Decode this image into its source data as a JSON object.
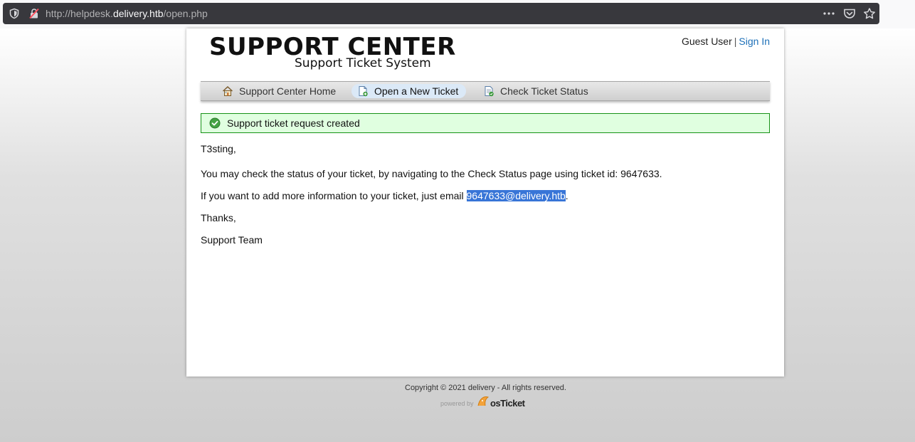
{
  "browser": {
    "url_prefix": "http://helpdesk.",
    "url_host": "delivery.htb",
    "url_path": "/open.php",
    "icons": [
      "shield-icon",
      "insecure-lock-icon",
      "more-icon",
      "pocket-icon",
      "bookmark-star-icon"
    ]
  },
  "header": {
    "title": "SUPPORT CENTER",
    "subtitle": "Support Ticket System",
    "guest_label": "Guest User",
    "separator": "|",
    "sign_in": "Sign In"
  },
  "nav": {
    "items": [
      {
        "label": "Support Center Home",
        "icon": "home-icon"
      },
      {
        "label": "Open a New Ticket",
        "icon": "new-ticket-icon"
      },
      {
        "label": "Check Ticket Status",
        "icon": "ticket-status-icon"
      }
    ],
    "active_index": 1
  },
  "notice": {
    "message": "Support ticket request created",
    "color": "#e0ffe0",
    "border_color": "#179317"
  },
  "content": {
    "greeting": "T3sting,",
    "status_line": "You may check the status of your ticket, by navigating to the Check Status page using ticket id: 9647633.",
    "email_prefix": "If you want to add more information to your ticket, just email ",
    "email": "9647633@delivery.htb",
    "email_suffix": ".",
    "thanks": "Thanks,",
    "signature": "Support Team"
  },
  "footer": {
    "copyright": "Copyright © 2021 delivery - All rights reserved.",
    "powered_by": "powered by",
    "brand": "osTicket"
  },
  "colors": {
    "link": "#1d70b8",
    "selection": "#3875d7",
    "urlbar": "#38383d"
  }
}
